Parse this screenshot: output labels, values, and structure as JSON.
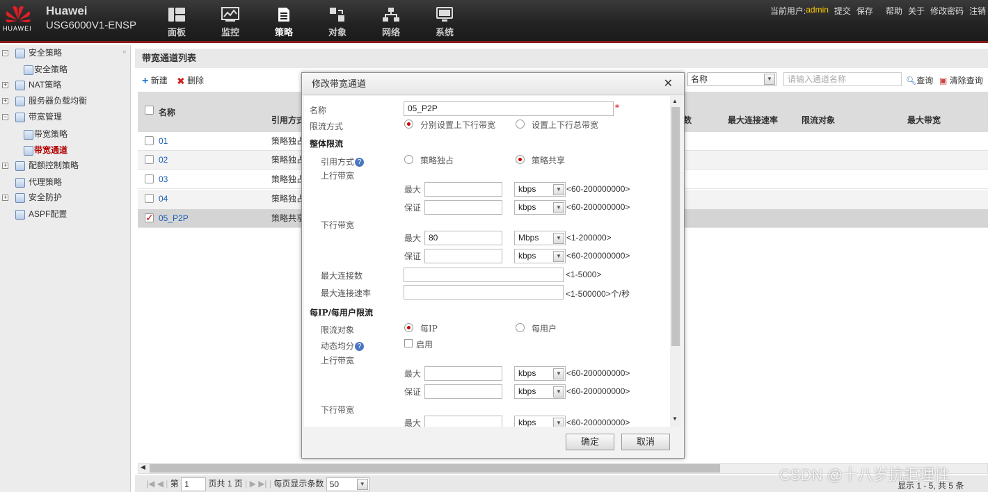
{
  "header": {
    "logo_text": "HUAWEI",
    "brand": "Huawei",
    "device": "USG6000V1-ENSP",
    "nav": [
      {
        "label": "面板",
        "icon": "dashboard-icon"
      },
      {
        "label": "监控",
        "icon": "monitor-icon"
      },
      {
        "label": "策略",
        "icon": "policy-icon",
        "active": true
      },
      {
        "label": "对象",
        "icon": "object-icon"
      },
      {
        "label": "网络",
        "icon": "network-icon"
      },
      {
        "label": "系统",
        "icon": "system-icon"
      }
    ],
    "current_user_label": "当前用户:",
    "current_user": "admin",
    "links": [
      "提交",
      "保存",
      "帮助",
      "关于",
      "修改密码",
      "注销"
    ]
  },
  "sidebar": {
    "items": [
      {
        "label": "安全策略"
      },
      {
        "label": "安全策略"
      },
      {
        "label": "NAT策略"
      },
      {
        "label": "服务器负载均衡"
      },
      {
        "label": "带宽管理"
      },
      {
        "label": "带宽策略"
      },
      {
        "label": "带宽通道",
        "selected": true
      },
      {
        "label": "配额控制策略"
      },
      {
        "label": "代理策略"
      },
      {
        "label": "安全防护"
      },
      {
        "label": "ASPF配置"
      }
    ]
  },
  "main": {
    "title": "带宽通道列表",
    "toolbar": {
      "new_label": "新建",
      "delete_label": "删除"
    },
    "filter": {
      "field": "名称",
      "placeholder": "请输入通道名称",
      "search_label": "查询",
      "clear_label": "清除查询"
    },
    "columns": {
      "name": "名称",
      "quote": "引用方式",
      "partial": "数",
      "max_conn_rate": "最大连接速率",
      "limit_obj": "限流对象",
      "max_bw": "最大带宽"
    },
    "rows": [
      {
        "name": "01",
        "quote": "策略独占",
        "checked": false
      },
      {
        "name": "02",
        "quote": "策略独占",
        "checked": false
      },
      {
        "name": "03",
        "quote": "策略独占",
        "checked": false
      },
      {
        "name": "04",
        "quote": "策略独占",
        "checked": false
      },
      {
        "name": "05_P2P",
        "quote": "策略共享",
        "checked": true
      }
    ],
    "pager": {
      "page_prefix": "第",
      "page": "1",
      "total_pages": "页共 1 页",
      "per_page_label": "每页显示条数",
      "per_page": "50",
      "info": "显示 1 - 5, 共 5 条"
    }
  },
  "dialog": {
    "title": "修改带宽通道",
    "name_label": "名称",
    "name_value": "05_P2P",
    "mode_label": "限流方式",
    "mode_opt1": "分别设置上下行带宽",
    "mode_opt2": "设置上下行总带宽",
    "overall_section": "整体限流",
    "quote_label": "引用方式",
    "quote_opt1": "策略独占",
    "quote_opt2": "策略共享",
    "up_label": "上行带宽",
    "down_label": "下行带宽",
    "max_label": "最大",
    "guar_label": "保证",
    "up_max": {
      "value": "",
      "unit": "kbps",
      "range": "<60-200000000>"
    },
    "up_guar": {
      "value": "",
      "unit": "kbps",
      "range": "<60-200000000>"
    },
    "down_max": {
      "value": "80",
      "unit": "Mbps",
      "range": "<1-200000>"
    },
    "down_guar": {
      "value": "",
      "unit": "kbps",
      "range": "<60-200000000>"
    },
    "max_conn_label": "最大连接数",
    "max_conn_range": "<1-5000>",
    "max_rate_label": "最大连接速率",
    "max_rate_range": "<1-500000>",
    "max_rate_unit": "个/秒",
    "perip_section": "每IP/每用户限流",
    "limit_obj_label": "限流对象",
    "limit_opt1": "每IP",
    "limit_opt2": "每用户",
    "dyn_label": "动态均分",
    "enable_label": "启用",
    "ip_up_max": {
      "value": "",
      "unit": "kbps",
      "range": "<60-200000000>"
    },
    "ip_up_guar": {
      "value": "",
      "unit": "kbps",
      "range": "<60-200000000>"
    },
    "ip_down_max": {
      "value": "",
      "unit": "kbps",
      "range": "<60-200000000>"
    },
    "ok_label": "确定",
    "cancel_label": "取消"
  },
  "watermark": "CSDN @十八岁抗拒理性"
}
